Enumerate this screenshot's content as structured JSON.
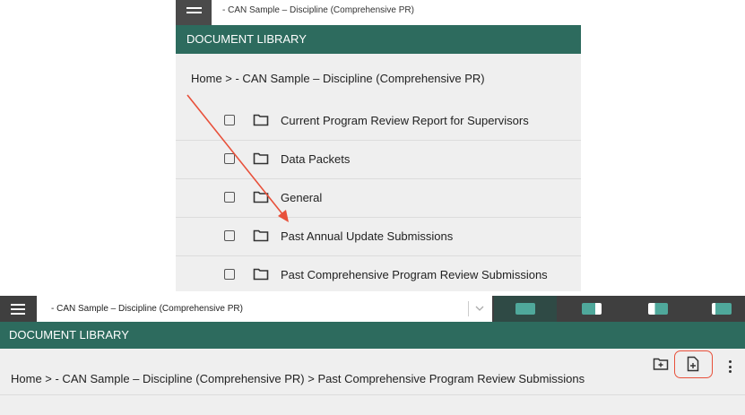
{
  "top": {
    "title": "- CAN Sample – Discipline (Comprehensive PR)",
    "header": "DOCUMENT LIBRARY",
    "breadcrumb": "Home > - CAN Sample – Discipline (Comprehensive PR)",
    "folders": [
      {
        "label": "Current Program Review Report for Supervisors",
        "icon": "folder-icon"
      },
      {
        "label": "Data Packets",
        "icon": "folder-icon"
      },
      {
        "label": "General",
        "icon": "folder-icon"
      },
      {
        "label": "Past Annual Update Submissions",
        "icon": "folder-icon"
      },
      {
        "label": "Past Comprehensive Program Review Submissions",
        "icon": "folder-icon"
      }
    ]
  },
  "bottom": {
    "selector_value": "- CAN Sample – Discipline (Comprehensive PR)",
    "header": "DOCUMENT LIBRARY",
    "breadcrumb": "Home > - CAN Sample – Discipline (Comprehensive PR) > Past Comprehensive Program Review Submissions",
    "actions": [
      "add-folder-icon",
      "add-file-icon",
      "more-vert-icon"
    ],
    "layout_buttons": [
      "layout-full-icon",
      "layout-right-icon",
      "layout-split-icon",
      "layout-left-icon"
    ]
  },
  "colors": {
    "brand_green": "#2d6b5e",
    "layout_icon": "#4fa89b",
    "annotation_red": "#e8503a",
    "dark_bar": "#3f3f3f"
  }
}
